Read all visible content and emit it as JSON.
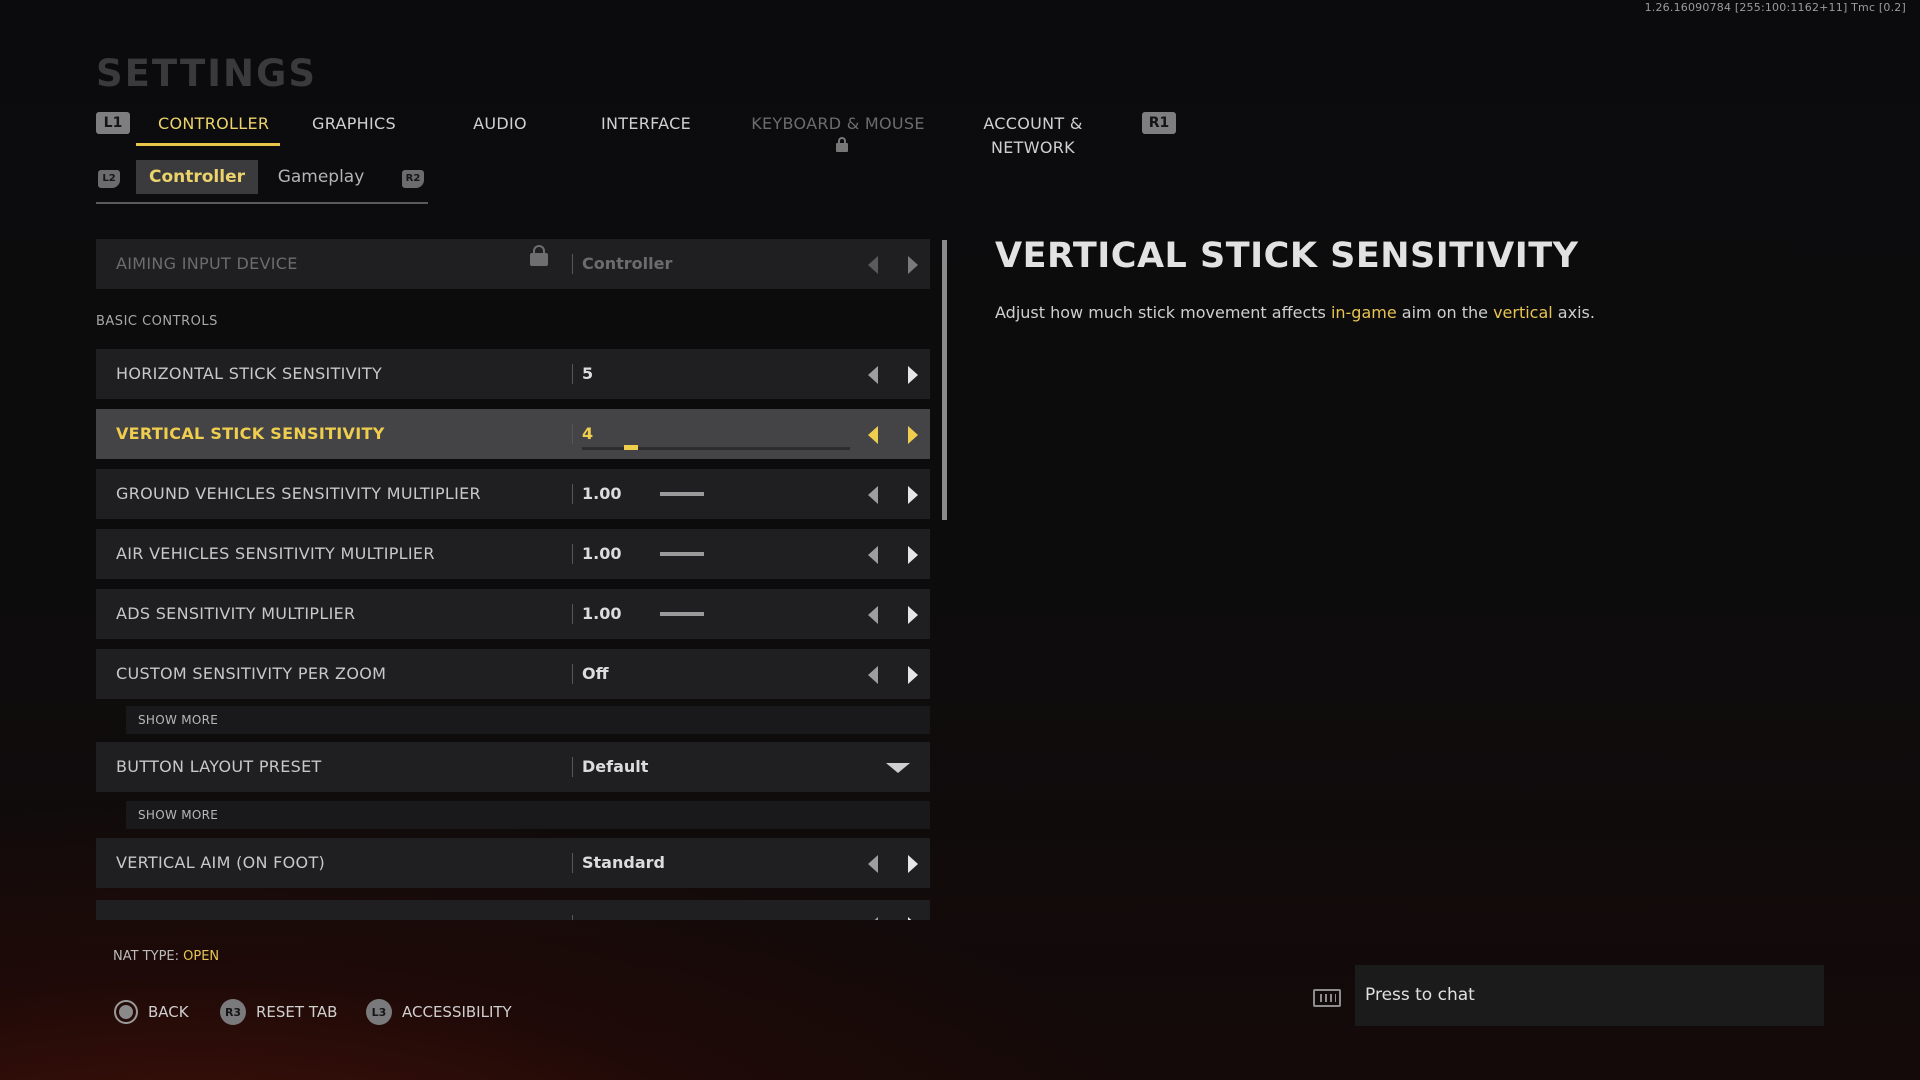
{
  "version": "1.26.16090784 [255:100:1162+11] Tmc [0.2]",
  "page_title": "SETTINGS",
  "tabs": {
    "prev_button": "L1",
    "next_button": "R1",
    "items": [
      {
        "label": "CONTROLLER",
        "state": "active"
      },
      {
        "label": "GRAPHICS",
        "state": "normal"
      },
      {
        "label": "AUDIO",
        "state": "normal"
      },
      {
        "label": "INTERFACE",
        "state": "normal"
      },
      {
        "label": "KEYBOARD & MOUSE",
        "state": "locked"
      },
      {
        "label": "ACCOUNT & NETWORK",
        "state": "normal"
      }
    ]
  },
  "subtabs": {
    "prev_button": "L2",
    "next_button": "R2",
    "items": [
      {
        "label": "Controller",
        "state": "active"
      },
      {
        "label": "Gameplay",
        "state": "normal"
      }
    ]
  },
  "settings": {
    "aiming_input": {
      "label": "AIMING INPUT DEVICE",
      "value": "Controller",
      "locked": true
    },
    "section_basic": "BASIC CONTROLS",
    "rows": [
      {
        "label": "HORIZONTAL STICK SENSITIVITY",
        "value": "5"
      },
      {
        "label": "VERTICAL STICK SENSITIVITY",
        "value": "4",
        "selected": true,
        "slider_fraction": 0.18
      },
      {
        "label": "GROUND VEHICLES SENSITIVITY MULTIPLIER",
        "value": "1.00"
      },
      {
        "label": "AIR VEHICLES SENSITIVITY MULTIPLIER",
        "value": "1.00"
      },
      {
        "label": "ADS SENSITIVITY MULTIPLIER",
        "value": "1.00"
      },
      {
        "label": "CUSTOM SENSITIVITY PER ZOOM",
        "value": "Off"
      }
    ],
    "show_more_1": "SHOW MORE",
    "button_layout": {
      "label": "BUTTON LAYOUT PRESET",
      "value": "Default"
    },
    "show_more_2": "SHOW MORE",
    "vertical_aim": {
      "label": "VERTICAL AIM (ON FOOT)",
      "value": "Standard"
    }
  },
  "detail": {
    "title": "VERTICAL STICK SENSITIVITY",
    "desc_1": "Adjust how much stick movement affects ",
    "desc_hl_1": "in-game",
    "desc_2": " aim on the ",
    "desc_hl_2": "vertical",
    "desc_3": " axis."
  },
  "footer": {
    "nat_label": "NAT TYPE: ",
    "nat_value": "OPEN",
    "back": "BACK",
    "reset_button": "R3",
    "reset": "RESET TAB",
    "accessibility_button": "L3",
    "accessibility": "ACCESSIBILITY"
  },
  "chat": {
    "placeholder": "Press to chat"
  },
  "colors": {
    "accent": "#efce4e",
    "row_bg": "#1f1f21",
    "row_selected_bg": "#444447"
  }
}
